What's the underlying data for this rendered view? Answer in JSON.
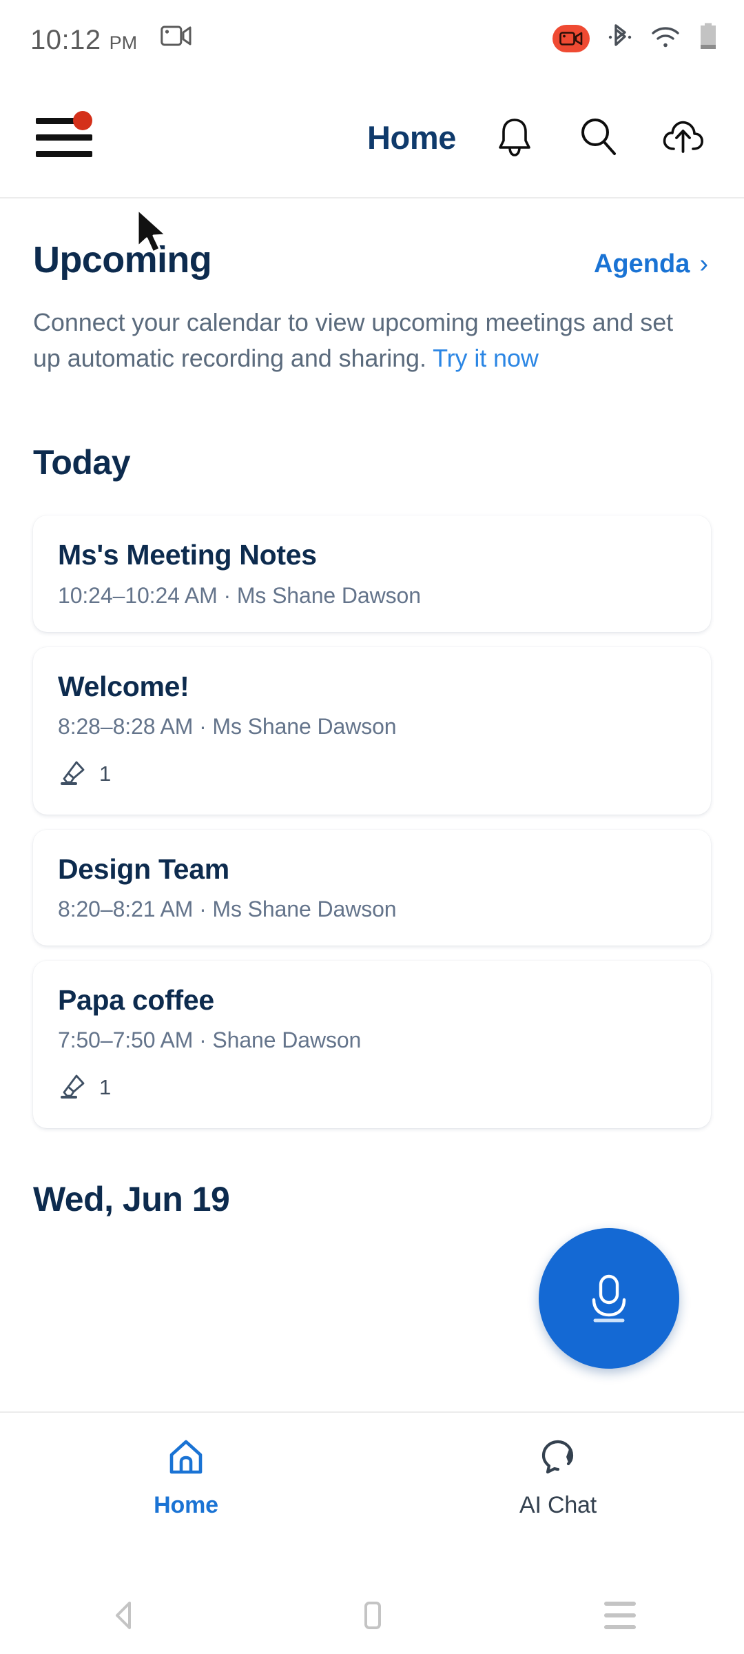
{
  "status_bar": {
    "time": "10:12",
    "ampm": "PM",
    "icons": [
      "screen-record-icon",
      "screen-recording-badge-icon",
      "bluetooth-icon",
      "wifi-icon",
      "battery-icon"
    ]
  },
  "header": {
    "title": "Home",
    "menu_icon": "hamburger-menu-icon",
    "menu_badge": true,
    "actions": [
      "bell-icon",
      "search-icon",
      "cloud-upload-icon"
    ],
    "badge_color": "#d4301a",
    "title_color": "#0f3a6b"
  },
  "upcoming": {
    "title": "Upcoming",
    "agenda_label": "Agenda",
    "agenda_chevron": "›",
    "description_prefix": "Connect your calendar to view upcoming meetings and set up automatic recording and sharing. ",
    "try_link": "Try it now",
    "link_color": "#1a73d4"
  },
  "today": {
    "heading": "Today",
    "cards": [
      {
        "title": "Ms's Meeting Notes",
        "subtitle": "10:24–10:24 AM ·  Ms Shane Dawson",
        "has_highlight": false,
        "highlight_count": ""
      },
      {
        "title": "Welcome!",
        "subtitle": "8:28–8:28 AM ·  Ms Shane Dawson",
        "has_highlight": true,
        "highlight_count": "1"
      },
      {
        "title": "Design Team",
        "subtitle": "8:20–8:21 AM ·  Ms Shane Dawson",
        "has_highlight": false,
        "highlight_count": ""
      },
      {
        "title": "Papa coffee",
        "subtitle": "7:50–7:50 AM ·  Shane Dawson",
        "has_highlight": true,
        "highlight_count": "1"
      }
    ]
  },
  "next_date": {
    "heading": "Wed, Jun 19"
  },
  "fab": {
    "icon": "microphone-icon",
    "color": "#1469d4"
  },
  "bottom_nav": {
    "items": [
      {
        "label": "Home",
        "icon": "home-icon",
        "active": true
      },
      {
        "label": "AI Chat",
        "icon": "ai-chat-bubble-icon",
        "active": false
      }
    ],
    "active_color": "#1a73d4",
    "inactive_color": "#34414f"
  },
  "system_nav": {
    "back": "back-triangle-icon",
    "home": "home-square-icon",
    "recents": "recents-lines-icon"
  },
  "cursor": {
    "icon": "mouse-pointer-arrow"
  }
}
